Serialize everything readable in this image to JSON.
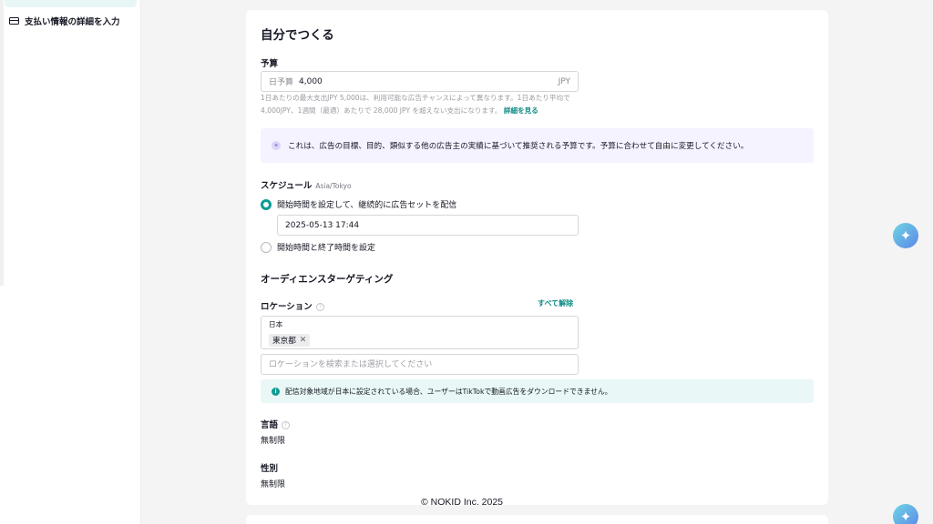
{
  "sidebar": {
    "items": [
      {
        "label": "支払い情報の詳細を入力"
      }
    ]
  },
  "card": {
    "title": "自分でつくる"
  },
  "budget": {
    "label": "予算",
    "prefix": "日予算",
    "value": "4,000",
    "unit": "JPY",
    "help_text": "1日あたりの最大支出JPY 5,000は、利用可能な広告チャンスによって異なります。1日あたり平均で4,000JPY、1週間（最適）あたりで 28,000 JPY を超えない支出になります。",
    "help_link": "詳細を見る",
    "recommend_text": "これは、広告の目標、目的、類似する他の広告主の実績に基づいて推奨される予算です。予算に合わせて自由に変更してください。"
  },
  "schedule": {
    "label": "スケジュール",
    "timezone": "Asia/Tokyo",
    "option1": "開始時間を設定して、継続的に広告セットを配信",
    "datetime": "2025-05-13 17:44",
    "option2": "開始時間と終了時間を設定"
  },
  "audience": {
    "title": "オーディエンスターゲティング",
    "location_label": "ロケーション",
    "clear_all": "すべて解除",
    "country": "日本",
    "selected_tag": "東京都",
    "search_placeholder": "ロケーションを検索または選択してください",
    "info_text": "配信対象地域が日本に設定されている場合、ユーザーはTikTokで動画広告をダウンロードできません。",
    "language_label": "言語",
    "language_value": "無制限",
    "gender_label": "性別",
    "gender_value": "無制限"
  },
  "footer": {
    "copyright": "© NOKID Inc. 2025"
  },
  "colors": {
    "accent": "#0d9b94",
    "link": "#0d8a84",
    "recommend_bg": "#f5f3ff",
    "info_bg": "#e9f8f6"
  }
}
